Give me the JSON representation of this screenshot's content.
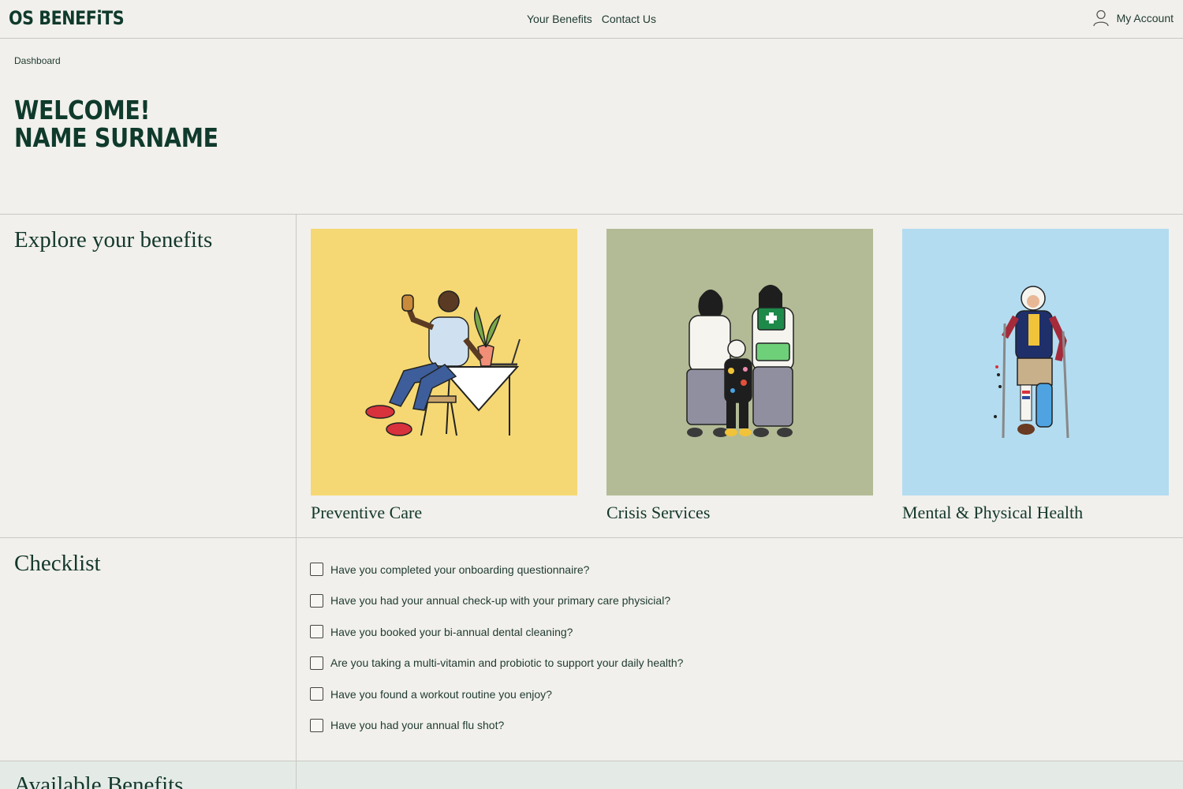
{
  "header": {
    "logo": "OS BENEFiTS",
    "nav": [
      "Your Benefits",
      "Contact Us"
    ],
    "account_label": "My Account"
  },
  "breadcrumb": "Dashboard",
  "welcome": {
    "line1": "WELCOME!",
    "line2": "NAME SURNAME"
  },
  "explore": {
    "title": "Explore your benefits",
    "cards": [
      {
        "label": "Preventive Care",
        "bg": "#f5d874"
      },
      {
        "label": "Crisis Services",
        "bg": "#b3bb96"
      },
      {
        "label": "Mental & Physical Health",
        "bg": "#b3dcf0"
      }
    ]
  },
  "checklist": {
    "title": "Checklist",
    "items": [
      "Have you completed your onboarding questionnaire?",
      "Have you had your annual check-up with your primary care physicial?",
      "Have you booked your bi-annual dental cleaning?",
      "Are you taking a multi-vitamin and probiotic to support your daily health?",
      "Have you found a workout routine you enjoy?",
      "Have you had your annual flu shot?"
    ]
  },
  "available": {
    "title": "Available Benefits"
  },
  "colors": {
    "brand": "#0f3a2c",
    "background": "#f1f0ec",
    "divider": "#c9c8c3"
  }
}
